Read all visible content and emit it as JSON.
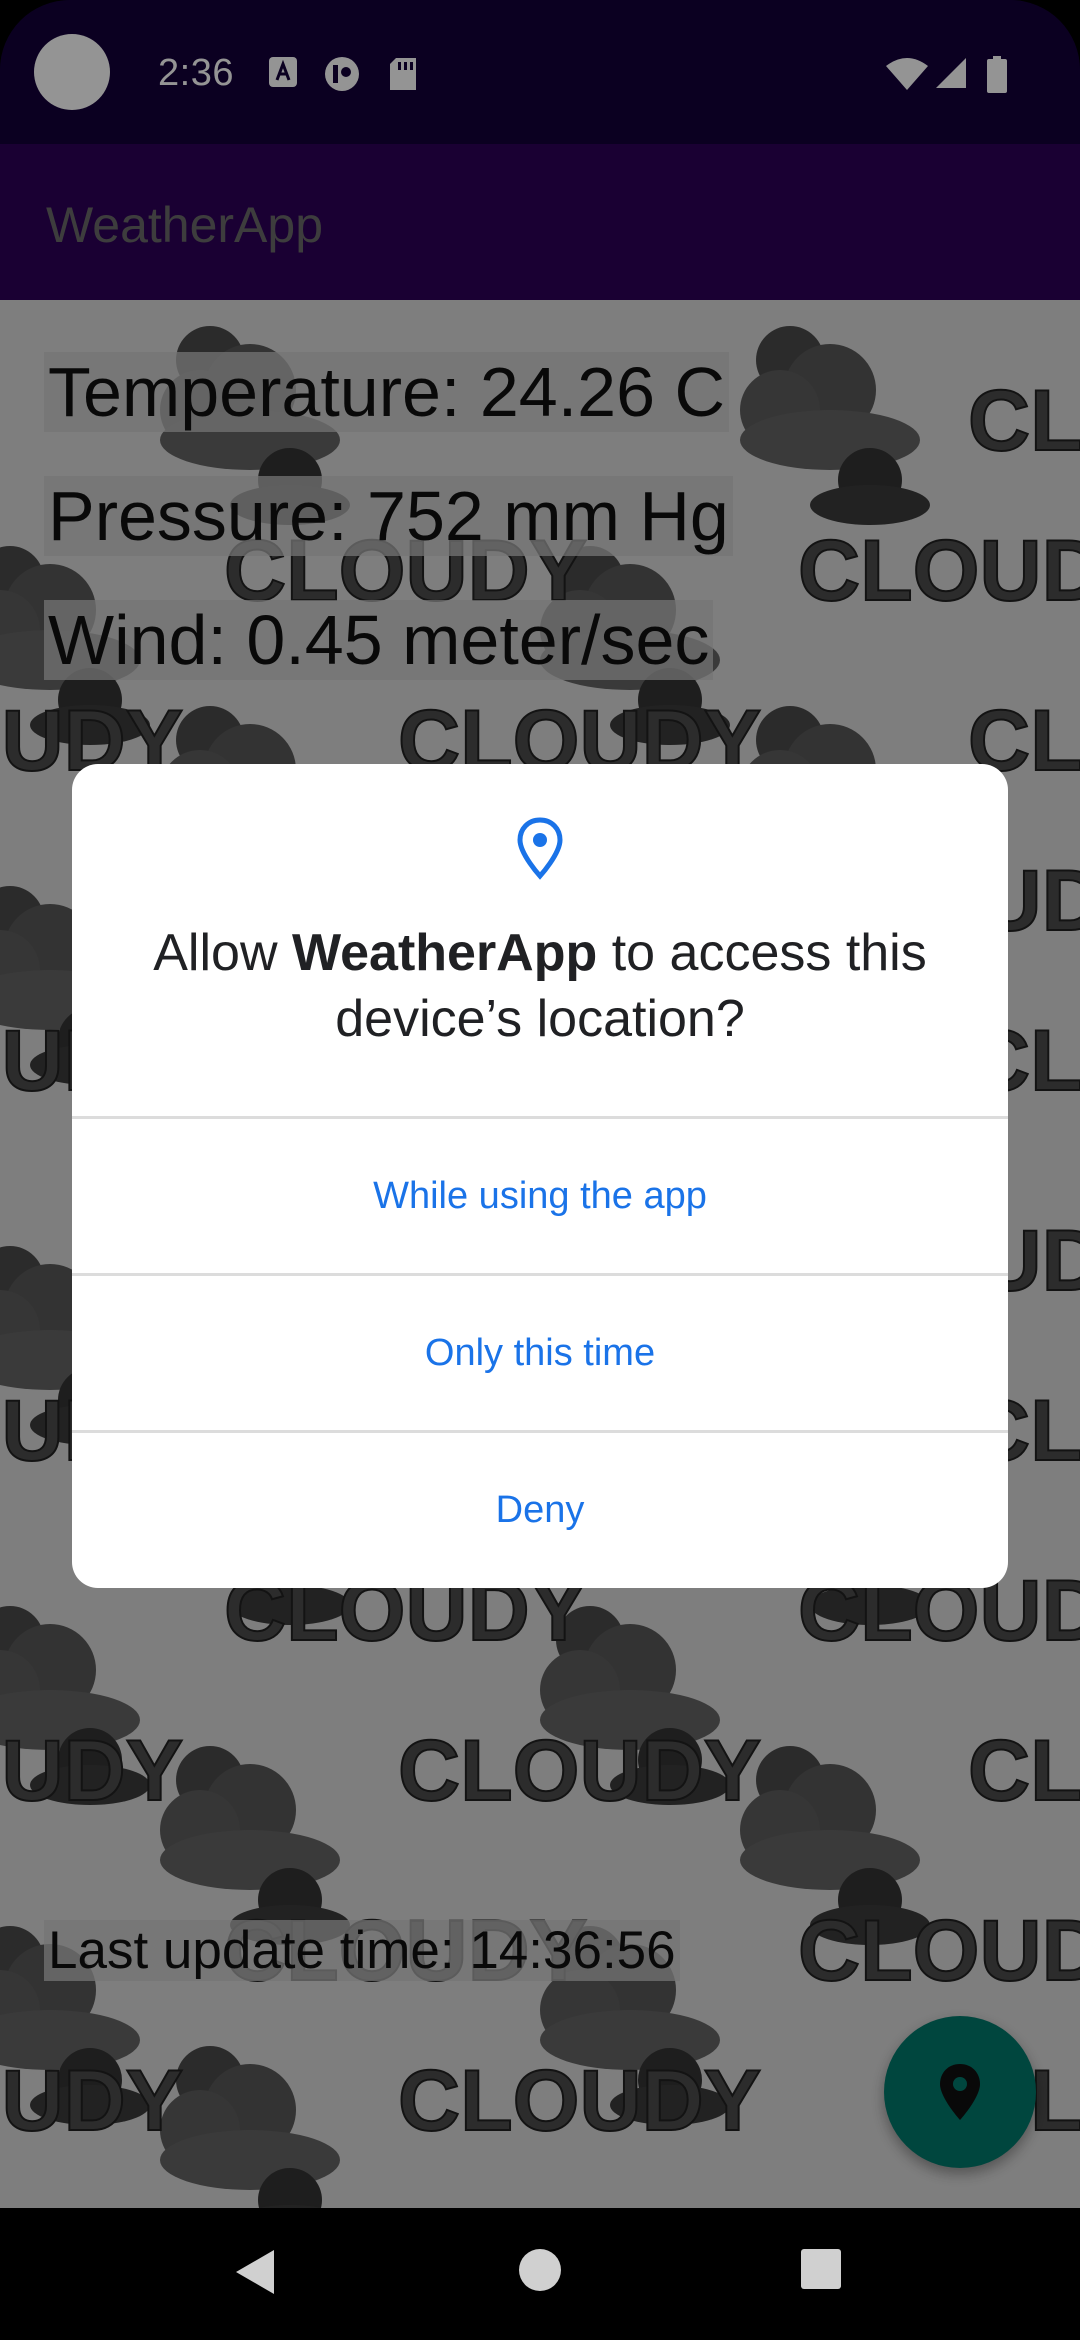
{
  "status_bar": {
    "time": "2:36",
    "icons": [
      "notification-a-icon",
      "notification-record-icon",
      "sd-card-icon",
      "wifi-icon",
      "signal-icon",
      "battery-icon"
    ]
  },
  "app_bar": {
    "title": "WeatherApp"
  },
  "weather": {
    "temperature_label": "Temperature:",
    "temperature_value": "24.26 C",
    "pressure_label": "Pressure:",
    "pressure_value": "752 mm Hg",
    "wind_label": "Wind:",
    "wind_value": "0.45 meter/sec",
    "background_word": "CLOUDY",
    "last_update_label": "Last update time:",
    "last_update_value": "14:36:56"
  },
  "dialog": {
    "icon": "location-pin-icon",
    "title_prefix": "Allow ",
    "title_app": "WeatherApp",
    "title_suffix": " to access this device’s location?",
    "options": [
      {
        "label": "While using the app"
      },
      {
        "label": "Only this time"
      },
      {
        "label": "Deny"
      }
    ],
    "accent_color": "#1a73e8"
  },
  "fab": {
    "icon": "location-pin-icon",
    "color": "#00796b"
  },
  "nav_bar": {
    "buttons": [
      "back-icon",
      "home-icon",
      "recents-icon"
    ]
  }
}
